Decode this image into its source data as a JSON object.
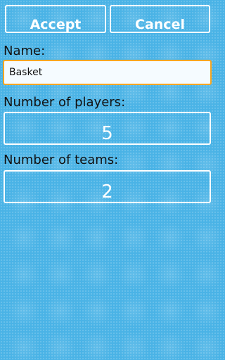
{
  "toolbar": {
    "accept_label": "Accept",
    "cancel_label": "Cancel"
  },
  "form": {
    "name_label": "Name:",
    "name_value": "Basket",
    "players_label": "Number of players:",
    "players_value": "5",
    "teams_label": "Number of teams:",
    "teams_value": "2"
  },
  "colors": {
    "background": "#4ab3e6",
    "focus_border": "#f5a623",
    "button_text": "#ffffff"
  }
}
